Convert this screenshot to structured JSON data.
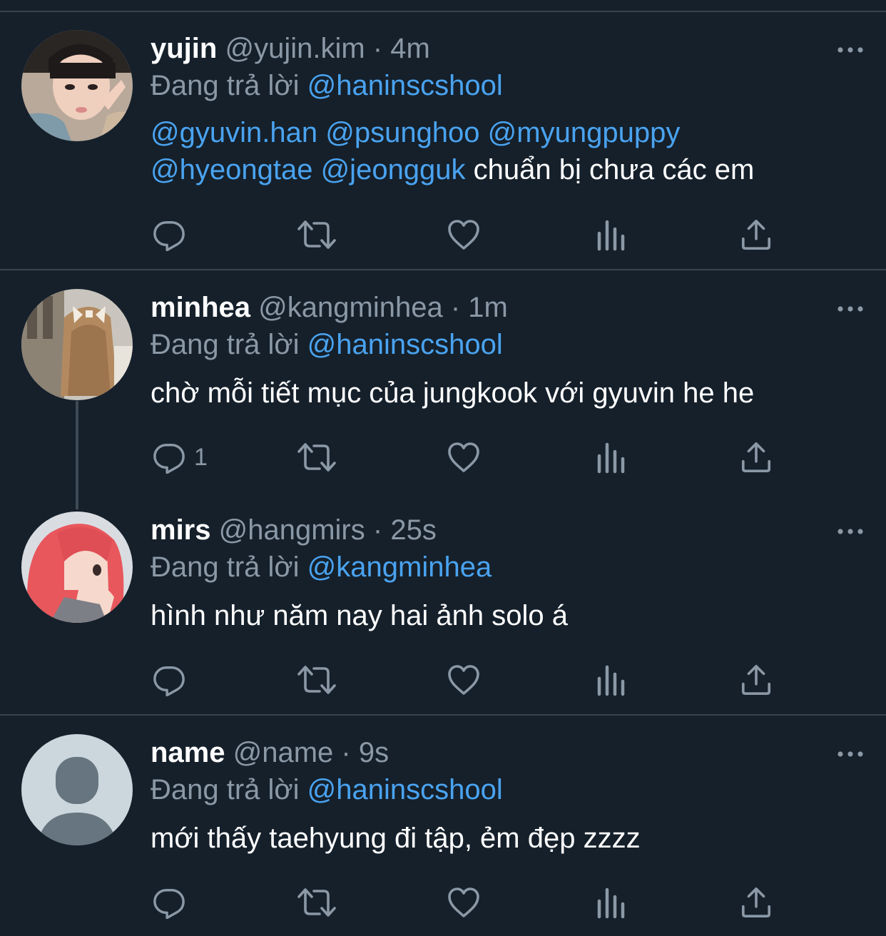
{
  "tweets": [
    {
      "name": "yujin",
      "handle": "@yujin.kim",
      "separator": "·",
      "time": "4m",
      "reply_prefix": "Đang trả lời",
      "reply_to": "@haninscshool",
      "mentions_line1": [
        "@gyuvin.han",
        "@psunghoo",
        "@myungpuppy"
      ],
      "mentions_line2": [
        "@hyeongtae",
        "@jeongguk"
      ],
      "text": "chuẩn bị chưa các em",
      "reply_count": ""
    },
    {
      "name": "minhea",
      "handle": "@kangminhea",
      "separator": "·",
      "time": "1m",
      "reply_prefix": "Đang trả lời",
      "reply_to": "@haninscshool",
      "text": "chờ mỗi tiết mục của jungkook với gyuvin he he",
      "reply_count": "1"
    },
    {
      "name": "mirs",
      "handle": "@hangmirs",
      "separator": "·",
      "time": "25s",
      "reply_prefix": "Đang trả lời",
      "reply_to": "@kangminhea",
      "text": "hình như năm nay hai ảnh solo á",
      "reply_count": ""
    },
    {
      "name": "name",
      "handle": "@name",
      "separator": "·",
      "time": "9s",
      "reply_prefix": "Đang trả lời",
      "reply_to": "@haninscshool",
      "text": "mới thấy taehyung đi tập, ẻm đẹp zzzz",
      "reply_count": ""
    }
  ],
  "colors": {
    "background": "#15202b",
    "divider": "#38444d",
    "secondary_text": "#8b98a5",
    "link": "#4aa3f0"
  },
  "icons": [
    "reply-icon",
    "retweet-icon",
    "like-icon",
    "analytics-icon",
    "share-icon",
    "more-options-icon"
  ]
}
